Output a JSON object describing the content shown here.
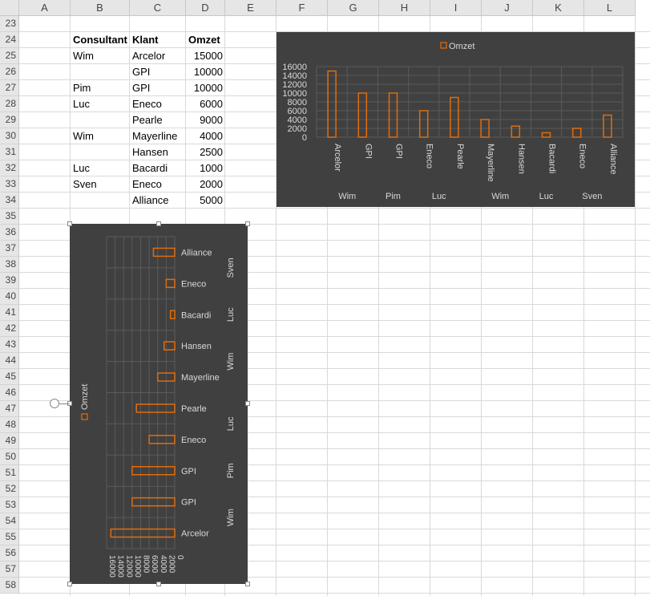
{
  "sheet": {
    "columns": [
      "A",
      "B",
      "C",
      "D",
      "E",
      "F",
      "G",
      "H",
      "I",
      "J",
      "K",
      "L"
    ],
    "rows": [
      "23",
      "24",
      "25",
      "26",
      "27",
      "28",
      "29",
      "30",
      "31",
      "32",
      "33",
      "34",
      "35",
      "36",
      "37",
      "38",
      "39",
      "40",
      "41",
      "42",
      "43",
      "44",
      "45",
      "46",
      "47",
      "48",
      "49",
      "50",
      "51",
      "52",
      "53",
      "54",
      "55",
      "56",
      "57",
      "58"
    ],
    "headers": {
      "consultant": "Consultant",
      "klant": "Klant",
      "omzet": "Omzet"
    },
    "table": [
      {
        "consultant": "Wim",
        "klant": "Arcelor",
        "omzet": "15000"
      },
      {
        "consultant": "",
        "klant": "GPI",
        "omzet": "10000"
      },
      {
        "consultant": "Pim",
        "klant": "GPI",
        "omzet": "10000"
      },
      {
        "consultant": "Luc",
        "klant": "Eneco",
        "omzet": "6000"
      },
      {
        "consultant": "",
        "klant": "Pearle",
        "omzet": "9000"
      },
      {
        "consultant": "Wim",
        "klant": "Mayerline",
        "omzet": "4000"
      },
      {
        "consultant": "",
        "klant": "Hansen",
        "omzet": "2500"
      },
      {
        "consultant": "Luc",
        "klant": "Bacardi",
        "omzet": "1000"
      },
      {
        "consultant": "Sven",
        "klant": "Eneco",
        "omzet": "2000"
      },
      {
        "consultant": "",
        "klant": "Alliance",
        "omzet": "5000"
      }
    ]
  },
  "chart_data": [
    {
      "type": "bar",
      "orientation": "vertical",
      "categories": [
        "Arcelor",
        "GPI",
        "GPI",
        "Eneco",
        "Pearle",
        "Mayerline",
        "Hansen",
        "Bacardi",
        "Eneco",
        "Alliance"
      ],
      "group_labels": [
        {
          "label": "Wim",
          "span": [
            0,
            1
          ]
        },
        {
          "label": "Pim",
          "span": [
            2,
            2
          ]
        },
        {
          "label": "Luc",
          "span": [
            3,
            4
          ]
        },
        {
          "label": "Wim",
          "span": [
            5,
            6
          ]
        },
        {
          "label": "Luc",
          "span": [
            7,
            7
          ]
        },
        {
          "label": "Sven",
          "span": [
            8,
            9
          ]
        }
      ],
      "series": [
        {
          "name": "Omzet",
          "values": [
            15000,
            10000,
            10000,
            6000,
            9000,
            4000,
            2500,
            1000,
            2000,
            5000
          ]
        }
      ],
      "yticks": [
        "16000",
        "14000",
        "12000",
        "10000",
        "8000",
        "6000",
        "4000",
        "2000",
        "0"
      ],
      "ylim": [
        0,
        16000
      ],
      "legend": "top",
      "grid": true,
      "colors": {
        "background": "#404040",
        "bar": "#e36c0a",
        "text": "#d9d9d9",
        "grid": "#5a5a5a"
      }
    },
    {
      "type": "bar",
      "orientation": "rotated",
      "categories": [
        "Arcelor",
        "GPI",
        "GPI",
        "Eneco",
        "Pearle",
        "Mayerline",
        "Hansen",
        "Bacardi",
        "Eneco",
        "Alliance"
      ],
      "group_labels": [
        {
          "label": "Wim",
          "span": [
            0,
            1
          ]
        },
        {
          "label": "Pim",
          "span": [
            2,
            2
          ]
        },
        {
          "label": "Luc",
          "span": [
            3,
            4
          ]
        },
        {
          "label": "Wim",
          "span": [
            5,
            6
          ]
        },
        {
          "label": "Luc",
          "span": [
            7,
            7
          ]
        },
        {
          "label": "Sven",
          "span": [
            8,
            9
          ]
        }
      ],
      "series": [
        {
          "name": "Omzet",
          "values": [
            15000,
            10000,
            10000,
            6000,
            9000,
            4000,
            2500,
            1000,
            2000,
            5000
          ]
        }
      ],
      "yticks": [
        "16000",
        "14000",
        "12000",
        "10000",
        "8000",
        "6000",
        "4000",
        "2000",
        "0"
      ],
      "ylim": [
        0,
        16000
      ],
      "legend": "left",
      "grid": true,
      "selected": true,
      "colors": {
        "background": "#404040",
        "bar": "#e36c0a",
        "text": "#d9d9d9",
        "grid": "#5a5a5a"
      }
    }
  ]
}
